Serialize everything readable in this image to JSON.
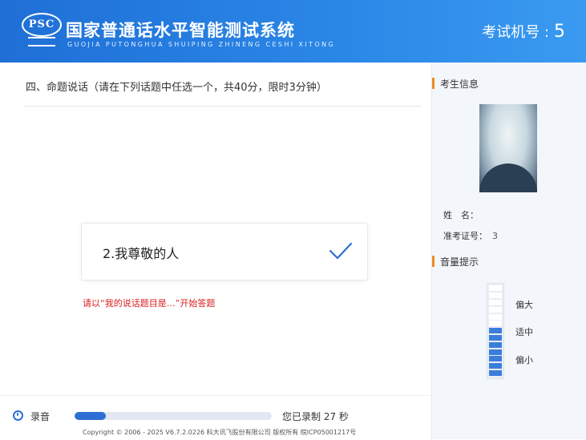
{
  "header": {
    "logo_text": "PSC",
    "title": "国家普通话水平智能测试系统",
    "subtitle": "GUOJIA PUTONGHUA SHUIPING ZHINENG CESHI XITONG",
    "seat_label": "考试机号 :",
    "seat_number": "5"
  },
  "question": {
    "title": "四、命题说话（请在下列话题中任选一个，共40分，限时3分钟）",
    "topic": "2.我尊敬的人",
    "hint": "请以“我的说话题目是…”开始答题"
  },
  "sidebar": {
    "candidate_section": "考生信息",
    "name_label": "姓　名：",
    "name_value": "",
    "id_label": "准考证号：",
    "id_value": "3",
    "volume_section": "音量提示",
    "volume_levels": [
      "偏大",
      "适中",
      "偏小"
    ],
    "volume_level_segments_on": 7,
    "volume_total_segments": 13
  },
  "footer": {
    "record_label": "录音",
    "progress_fraction": 0.16,
    "record_status": "您已录制 27 秒",
    "copyright": "Copyright © 2006 - 2025 V6.7.2.0226 科大讯飞股份有限公司 版权所有 皖ICP05001217号"
  },
  "colors": {
    "header_blue": "#2a86e6",
    "accent_orange": "#f08a24",
    "hint_red": "#d81e1e",
    "progress_blue": "#2d6fd4"
  }
}
